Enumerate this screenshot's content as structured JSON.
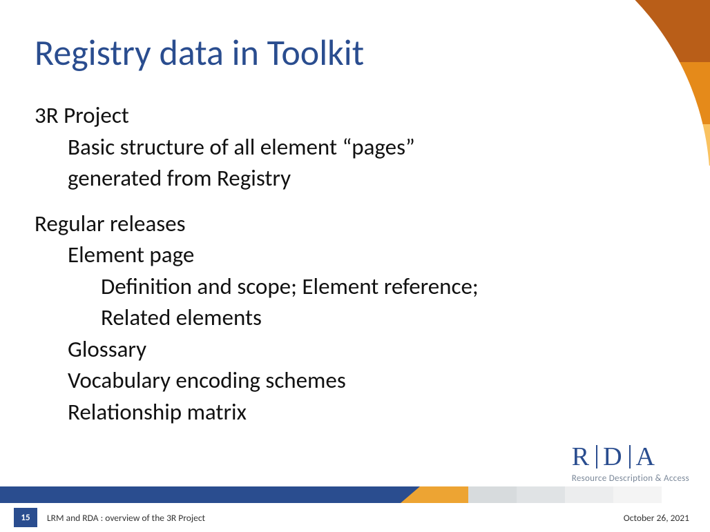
{
  "title": "Registry data in Toolkit",
  "content": {
    "section1": {
      "heading": "3R Project",
      "line1": "Basic structure of all element “pages”",
      "line2": "generated from Registry"
    },
    "section2": {
      "heading": "Regular releases",
      "item1": "Element page",
      "item1_sub1": "Definition and scope; Element reference;",
      "item1_sub2": "Related elements",
      "item2": "Glossary",
      "item3": "Vocabulary encoding schemes",
      "item4": "Relationship matrix"
    }
  },
  "brand": {
    "letters": {
      "r": "R",
      "d": "D",
      "a": "A"
    },
    "tagline": "Resource Description & Access"
  },
  "footer": {
    "page": "15",
    "title": "LRM and RDA : overview of the 3R Project",
    "date": "October 26, 2021"
  }
}
